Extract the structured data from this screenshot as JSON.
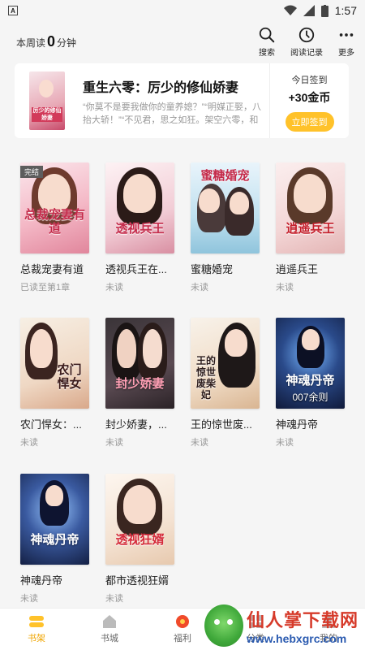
{
  "status": {
    "time": "1:57"
  },
  "header": {
    "read_prefix": "本周读",
    "read_minutes": "0",
    "read_suffix": "分钟",
    "actions": [
      {
        "label": "搜索",
        "icon": "search-icon"
      },
      {
        "label": "阅读记录",
        "icon": "clock-icon"
      },
      {
        "label": "更多",
        "icon": "more-icon"
      }
    ]
  },
  "banner": {
    "title": "重生六零：厉少的修仙娇妻",
    "desc": "“你莫不是要我做你的童养媳？”“明媒正娶，八抬大轿！”“不见君，思之如狂。架空六零，和真实",
    "cover_text": "厉少的修仙娇妻",
    "sign_label": "今日签到",
    "sign_reward": "+30金币",
    "sign_button": "立即签到"
  },
  "books": [
    {
      "title": "总裁宠妻有道",
      "status": "已读至第1章",
      "cover_text": "总裁宠妻有道",
      "badge": "完结"
    },
    {
      "title": "透视兵王在...",
      "status": "未读",
      "cover_text": "透视兵王"
    },
    {
      "title": "蜜糖婚宠",
      "status": "未读",
      "cover_text": "蜜糖婚宠"
    },
    {
      "title": "逍遥兵王",
      "status": "未读",
      "cover_text": "逍遥兵王"
    },
    {
      "title": "农门悍女：...",
      "status": "未读",
      "cover_text": "农门悍女"
    },
    {
      "title": "封少娇妻，...",
      "status": "未读",
      "cover_text": "封少娇妻"
    },
    {
      "title": "王的惊世废...",
      "status": "未读",
      "cover_text": "王的惊世废柴妃"
    },
    {
      "title": "神魂丹帝",
      "status": "未读",
      "cover_text": "神魂丹帝",
      "cover_sub": "007余则"
    },
    {
      "title": "神魂丹帝",
      "status": "未读",
      "cover_text": "神魂丹帝"
    },
    {
      "title": "都市透视狂婿",
      "status": "未读",
      "cover_text": "透视狂婿"
    }
  ],
  "tabs": [
    {
      "label": "书架",
      "icon": "bookshelf-icon",
      "active": true
    },
    {
      "label": "书城",
      "icon": "store-icon"
    },
    {
      "label": "福利",
      "icon": "gift-icon"
    },
    {
      "label": "分类",
      "icon": "category-icon"
    },
    {
      "label": "我的",
      "icon": "profile-icon"
    }
  ],
  "watermark": {
    "cn": "仙人掌下载网",
    "url": "www.hebxgrc.com"
  },
  "colors": {
    "accent": "#ffc22a",
    "tab_active": "#f0a500"
  }
}
